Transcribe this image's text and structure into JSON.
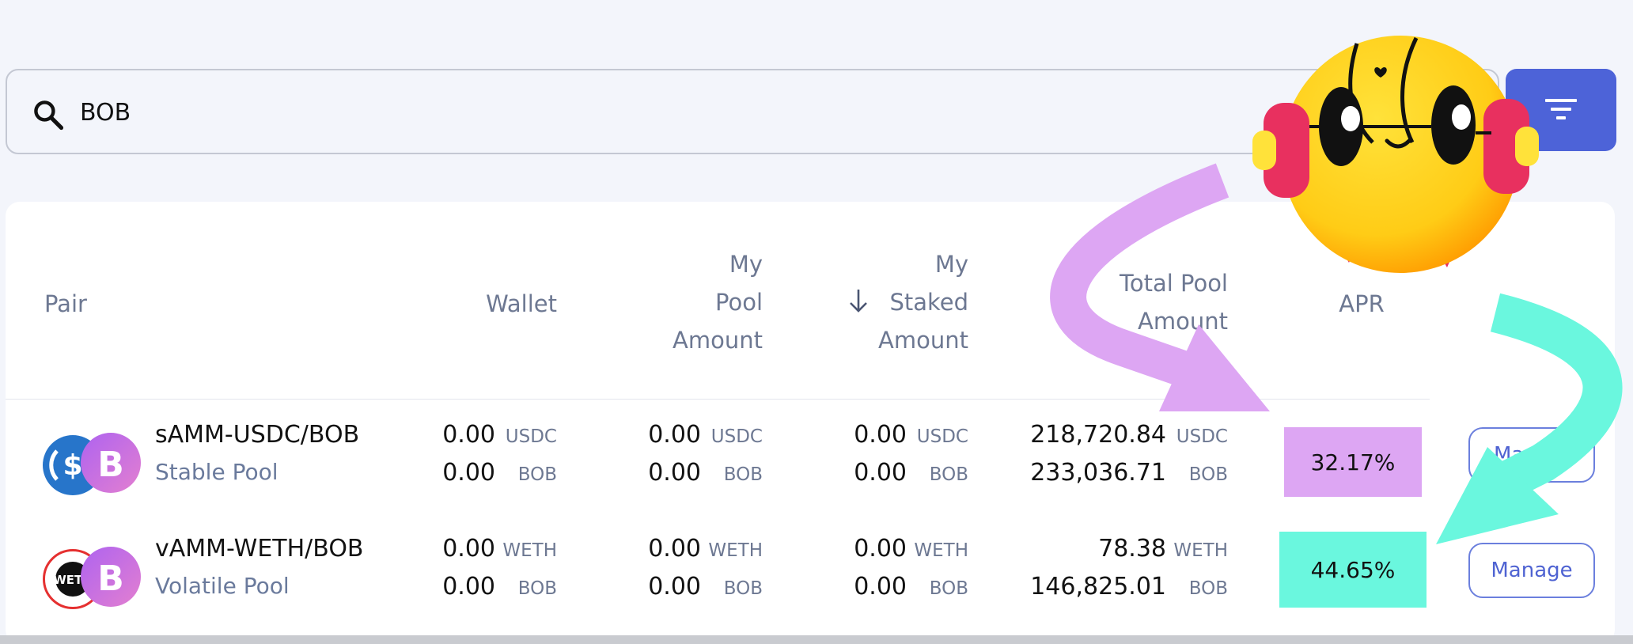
{
  "search": {
    "value": "BOB",
    "icon": "search-icon"
  },
  "filter": {
    "icon": "filter-icon",
    "color": "#4d63d8"
  },
  "table": {
    "headers": {
      "pair": "Pair",
      "wallet": "Wallet",
      "my_pool_1": "My",
      "my_pool_2": "Pool",
      "my_pool_3": "Amount",
      "my_staked_1": "My",
      "my_staked_2": "Staked",
      "my_staked_3": "Amount",
      "total_pool_1": "Total Pool",
      "total_pool_2": "Amount",
      "apr": "APR"
    },
    "rows": [
      {
        "name": "sAMM-USDC/BOB",
        "type": "Stable Pool",
        "wallet": [
          {
            "v": "0.00",
            "u": "USDC"
          },
          {
            "v": "0.00",
            "u": "BOB"
          }
        ],
        "pool": [
          {
            "v": "0.00",
            "u": "USDC"
          },
          {
            "v": "0.00",
            "u": "BOB"
          }
        ],
        "staked": [
          {
            "v": "0.00",
            "u": "USDC"
          },
          {
            "v": "0.00",
            "u": "BOB"
          }
        ],
        "total": [
          {
            "v": "218,720.84",
            "u": "USDC"
          },
          {
            "v": "233,036.71",
            "u": "BOB"
          }
        ],
        "apr": "32.17%",
        "apr_color": "#dda6f3",
        "action": "Manage",
        "action_visible": "Ma"
      },
      {
        "name": "vAMM-WETH/BOB",
        "type": "Volatile Pool",
        "wallet": [
          {
            "v": "0.00",
            "u": "WETH"
          },
          {
            "v": "0.00",
            "u": "BOB"
          }
        ],
        "pool": [
          {
            "v": "0.00",
            "u": "WETH"
          },
          {
            "v": "0.00",
            "u": "BOB"
          }
        ],
        "staked": [
          {
            "v": "0.00",
            "u": "WETH"
          },
          {
            "v": "0.00",
            "u": "BOB"
          }
        ],
        "total": [
          {
            "v": "78.38",
            "u": "WETH"
          },
          {
            "v": "146,825.01",
            "u": "BOB"
          }
        ],
        "apr": "44.65%",
        "apr_color": "#6af7de",
        "action": "Manage"
      }
    ]
  },
  "colors": {
    "background": "#f3f5fb",
    "accent": "#4d63d8",
    "header_text": "#6d7892",
    "subtitle_text": "#6a7a9c",
    "arrow_purple": "#dda6f3",
    "arrow_teal": "#6af7de"
  },
  "icons": {
    "usdc": "usdc-icon",
    "bob": "bob-icon",
    "weth": "weth-icon",
    "weth_text": "WETH",
    "sort": "arrow-down-icon",
    "mascot": "mascot-headphones-icon"
  }
}
